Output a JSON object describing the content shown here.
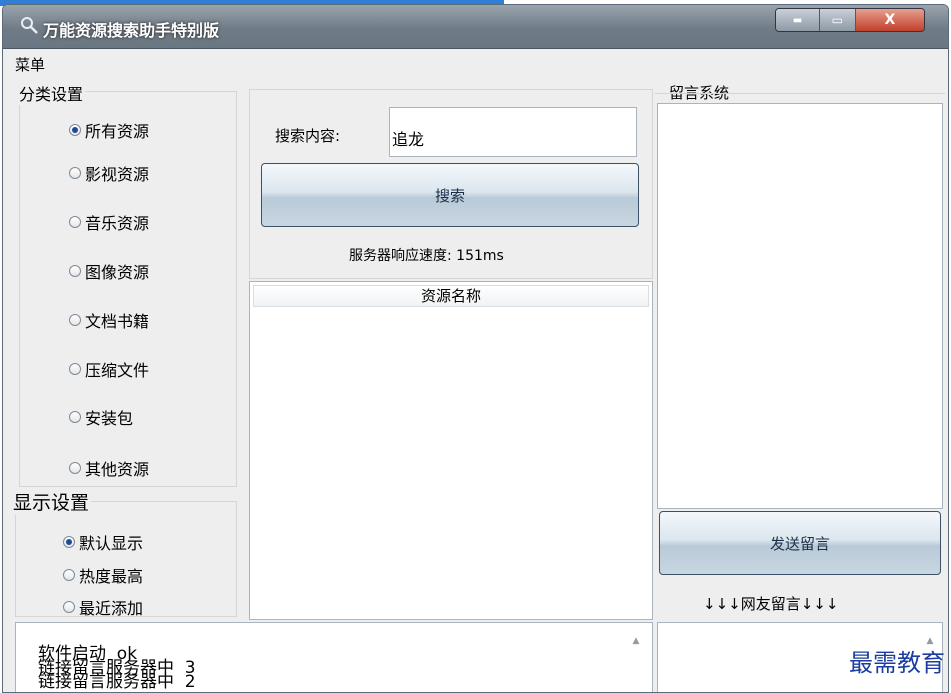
{
  "window": {
    "title": "万能资源搜索助手特别版",
    "controls": {
      "minimize": "▬",
      "maximize": "▭",
      "close": "X"
    }
  },
  "menu": {
    "label": "菜单"
  },
  "category_settings": {
    "title": "分类设置",
    "options": [
      {
        "label": "所有资源",
        "selected": true
      },
      {
        "label": "影视资源",
        "selected": false
      },
      {
        "label": "音乐资源",
        "selected": false
      },
      {
        "label": "图像资源",
        "selected": false
      },
      {
        "label": "文档书籍",
        "selected": false
      },
      {
        "label": "压缩文件",
        "selected": false
      },
      {
        "label": "安装包",
        "selected": false
      },
      {
        "label": "其他资源",
        "selected": false
      }
    ]
  },
  "display_settings": {
    "title": "显示设置",
    "options": [
      {
        "label": "默认显示",
        "selected": true
      },
      {
        "label": "热度最高",
        "selected": false
      },
      {
        "label": "最近添加",
        "selected": false
      }
    ]
  },
  "search": {
    "label": "搜索内容:",
    "value": "追龙",
    "button": "搜索",
    "status": "服务器响应速度: 151ms"
  },
  "results": {
    "column_header": "资源名称"
  },
  "message_system": {
    "title": "留言系统",
    "send_button": "发送留言",
    "netizen_label": "↓↓↓网友留言↓↓↓"
  },
  "log": {
    "lines": [
      "软件启动  ok",
      "链接留言服务器中  3",
      "链接留言服务器中  2"
    ]
  },
  "watermark": "最需教育"
}
